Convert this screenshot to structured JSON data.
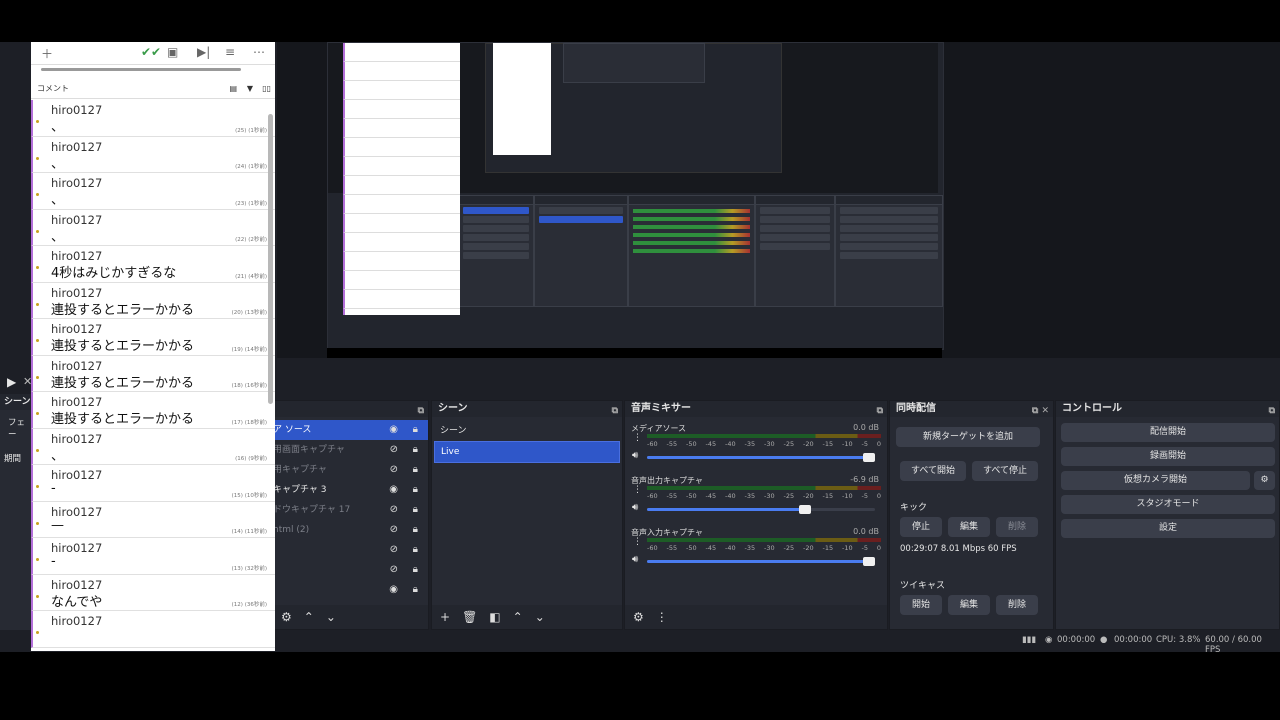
{
  "comment_panel": {
    "header_label": "コメント",
    "items": [
      {
        "user": "hiro0127",
        "message": "、",
        "meta": "(25) (1秒前)"
      },
      {
        "user": "hiro0127",
        "message": "、",
        "meta": "(24) (1秒前)"
      },
      {
        "user": "hiro0127",
        "message": "、",
        "meta": "(23) (1秒前)"
      },
      {
        "user": "hiro0127",
        "message": "、",
        "meta": "(22) (2秒前)"
      },
      {
        "user": "hiro0127",
        "message": "4秒はみじかすぎるな",
        "meta": "(21) (4秒前)"
      },
      {
        "user": "hiro0127",
        "message": "連投するとエラーかかる",
        "meta": "(20) (13秒前)"
      },
      {
        "user": "hiro0127",
        "message": "連投するとエラーかかる",
        "meta": "(19) (14秒前)"
      },
      {
        "user": "hiro0127",
        "message": "連投するとエラーかかる",
        "meta": "(18) (16秒前)"
      },
      {
        "user": "hiro0127",
        "message": "連投するとエラーかかる",
        "meta": "(17) (18秒前)"
      },
      {
        "user": "hiro0127",
        "message": "、",
        "meta": "(16) (9秒前)"
      },
      {
        "user": "hiro0127",
        "message": "-",
        "meta": "(15) (10秒前)"
      },
      {
        "user": "hiro0127",
        "message": "—",
        "meta": "(14) (11秒前)"
      },
      {
        "user": "hiro0127",
        "message": "-",
        "meta": "(13) (32秒前)"
      },
      {
        "user": "hiro0127",
        "message": "なんでや",
        "meta": "(12) (36秒前)"
      },
      {
        "user": "hiro0127",
        "message": "",
        "meta": ""
      }
    ]
  },
  "left_dock": {
    "title": "シーン",
    "items": [
      "フェー",
      "期間"
    ]
  },
  "sources": {
    "rows": [
      {
        "label": "ア ソース",
        "visible": true,
        "locked": true
      },
      {
        "label": "用画面キャプチャ",
        "visible": false,
        "locked": true
      },
      {
        "label": "用キャプチャ",
        "visible": false,
        "locked": true
      },
      {
        "label": "キャプチャ 3",
        "visible": true,
        "locked": true
      },
      {
        "label": "ドウキャプチャ 17",
        "visible": false,
        "locked": true
      },
      {
        "label": "html (2)",
        "visible": false,
        "locked": true
      },
      {
        "label": "",
        "visible": false,
        "locked": true
      },
      {
        "label": "",
        "visible": false,
        "locked": true
      },
      {
        "label": "",
        "visible": true,
        "locked": true
      }
    ]
  },
  "scenes": {
    "title": "シーン",
    "list_header": "シーン",
    "items": [
      "Live"
    ],
    "selected": "Live"
  },
  "mixer": {
    "title": "音声ミキサー",
    "ticks": [
      "-60",
      "-55",
      "-50",
      "-45",
      "-40",
      "-35",
      "-30",
      "-25",
      "-20",
      "-15",
      "-10",
      "-5",
      "0"
    ],
    "channels": [
      {
        "name": "メディアソース",
        "db": "0.0 dB",
        "volume": 1.0
      },
      {
        "name": "音声出力キャプチャ",
        "db": "-6.9 dB",
        "volume": 0.72
      },
      {
        "name": "音声入力キャプチャ",
        "db": "0.0 dB",
        "volume": 1.0
      }
    ]
  },
  "multistream": {
    "title": "同時配信",
    "add_target": "新規ターゲットを追加",
    "start_all": "すべて開始",
    "stop_all": "すべて停止",
    "kick": {
      "name": "キック",
      "stop": "停止",
      "edit": "編集",
      "delete": "削除",
      "stats": "00:29:07  8.01 Mbps  60 FPS"
    },
    "twitcasting": {
      "name": "ツイキャス",
      "start": "開始",
      "edit": "編集",
      "delete": "削除"
    }
  },
  "controls": {
    "title": "コントロール",
    "start_streaming": "配信開始",
    "start_recording": "録画開始",
    "start_virtualcam": "仮想カメラ開始",
    "studio_mode": "スタジオモード",
    "settings": "設定"
  },
  "status": {
    "stream_time": "00:00:00",
    "rec_time": "00:00:00",
    "cpu": "CPU: 3.8%",
    "fps": "60.00 / 60.00 FPS"
  },
  "colors": {
    "accent": "#2f57c9",
    "comment_border": "#b46fd9",
    "dock_bg": "#272a33"
  }
}
